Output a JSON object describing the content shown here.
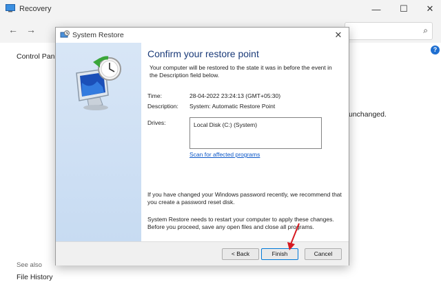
{
  "background_window": {
    "title": "Recovery",
    "nav": {
      "back": "←",
      "forward": "→"
    },
    "search_icon": "⌕",
    "help_icon": "?",
    "controls": {
      "minimize": "—",
      "maximize": "☐",
      "close": "✕"
    },
    "left_nav_title": "Control Panel",
    "body_text_fragment": "unchanged.",
    "see_also": "See also",
    "file_history": "File History"
  },
  "dialog": {
    "title": "System Restore",
    "close_glyph": "✕",
    "heading": "Confirm your restore point",
    "intro": "Your computer will be restored to the state it was in before the event in the Description field below.",
    "time_label": "Time:",
    "time_value": "28-04-2022 23:24:13 (GMT+05:30)",
    "description_label": "Description:",
    "description_value": "System: Automatic Restore Point",
    "drives_label": "Drives:",
    "drives": [
      "Local Disk (C:) (System)"
    ],
    "scan_link": "Scan for affected programs",
    "password_note": "If you have changed your Windows password recently, we recommend that you create a password reset disk.",
    "restart_note": "System Restore needs to restart your computer to apply these changes. Before you proceed, save any open files and close all programs.",
    "buttons": {
      "back": "< Back",
      "finish": "Finish",
      "cancel": "Cancel"
    }
  },
  "colors": {
    "heading": "#1a3a78",
    "link": "#0a56c7",
    "annotation_arrow": "#d71920",
    "side_panel": "#c7dbf2"
  }
}
